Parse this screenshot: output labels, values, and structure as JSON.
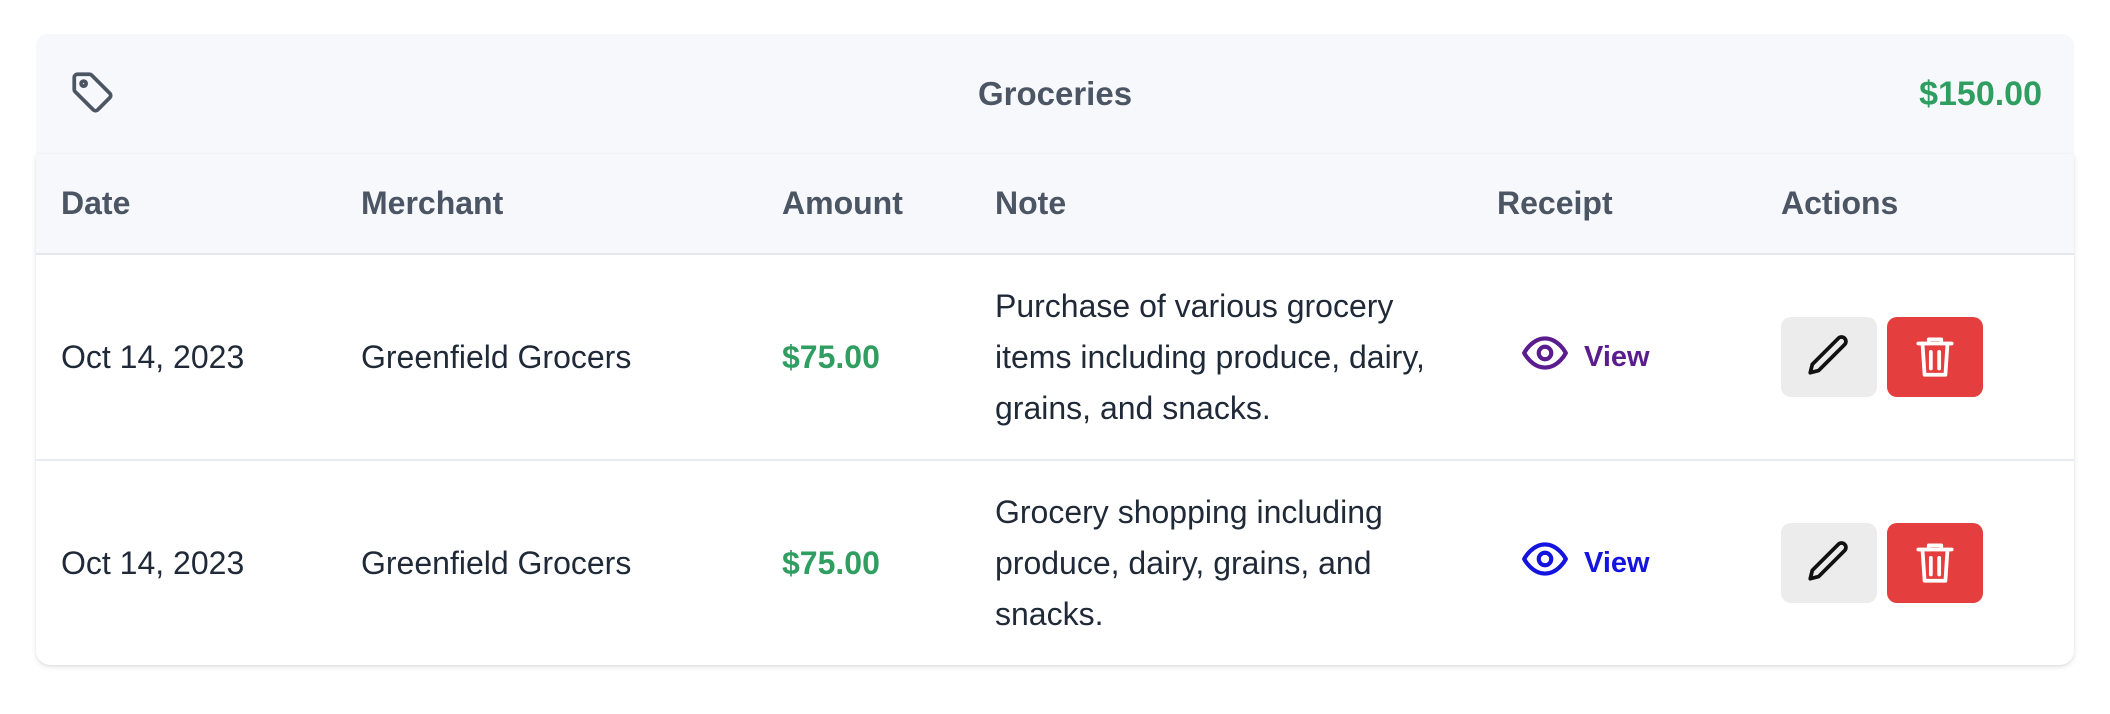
{
  "category": {
    "icon": "tag-icon",
    "title": "Groceries",
    "total": "$150.00"
  },
  "table": {
    "columns": [
      "Date",
      "Merchant",
      "Amount",
      "Note",
      "Receipt",
      "Actions"
    ],
    "rows": [
      {
        "date": "Oct 14, 2023",
        "merchant": "Greenfield Grocers",
        "amount": "$75.00",
        "note": "Purchase of various grocery items including produce, dairy, grains, and snacks.",
        "receipt_label": "View",
        "receipt_color": "#5b1c8f"
      },
      {
        "date": "Oct 14, 2023",
        "merchant": "Greenfield Grocers",
        "amount": "$75.00",
        "note": "Grocery shopping including produce, dairy, grains, and snacks.",
        "receipt_label": "View",
        "receipt_color": "#1414e0"
      }
    ]
  },
  "colors": {
    "amount": "#2f9e60",
    "delete_button": "#e53e3e",
    "edit_button": "#ececec",
    "header_bg": "#f6f8fb"
  }
}
